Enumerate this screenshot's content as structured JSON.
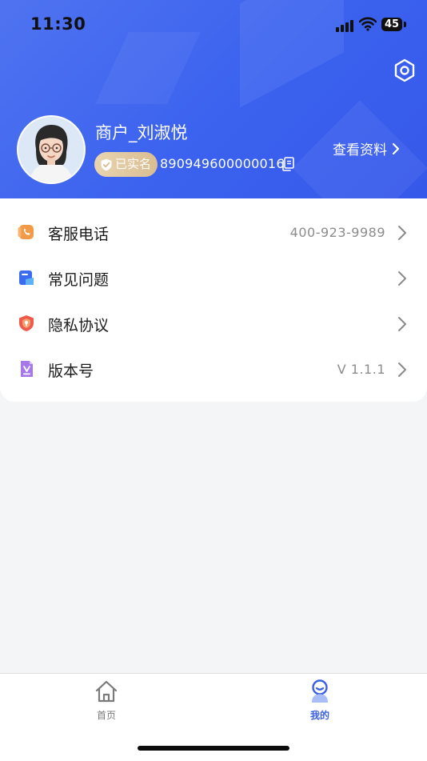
{
  "status_bar": {
    "time": "11:30",
    "battery": "45"
  },
  "profile": {
    "username": "商户_刘淑悦",
    "verified_label": "已实名",
    "account_number": "890949600000016",
    "view_profile_label": "查看资料"
  },
  "menu": {
    "items": [
      {
        "label": "客服电话",
        "value": "400-923-9989",
        "icon": "phone-icon"
      },
      {
        "label": "常见问题",
        "value": "",
        "icon": "faq-icon"
      },
      {
        "label": "隐私协议",
        "value": "",
        "icon": "shield-icon"
      },
      {
        "label": "版本号",
        "value": "V 1.1.1",
        "icon": "version-icon"
      }
    ]
  },
  "tabbar": {
    "tabs": [
      {
        "label": "首页",
        "icon": "home-icon",
        "active": false
      },
      {
        "label": "我的",
        "icon": "profile-icon",
        "active": true
      }
    ]
  },
  "colors": {
    "brand_blue": "#3b62ef",
    "verified_gold": "#dcc29a",
    "active_tab": "#3a5fe8"
  }
}
